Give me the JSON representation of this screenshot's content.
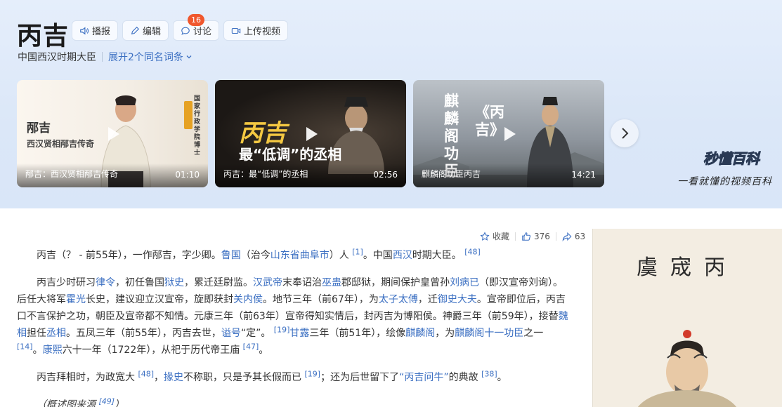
{
  "header": {
    "title": "丙吉",
    "actions": [
      {
        "label": "播报",
        "icon": "speaker-icon"
      },
      {
        "label": "编辑",
        "icon": "pencil-icon"
      },
      {
        "label": "讨论",
        "icon": "chat-icon",
        "badge": "16"
      },
      {
        "label": "上传视频",
        "icon": "video-icon"
      }
    ],
    "subtitle": "中国西汉时期大臣",
    "expand_label": "展开2个同名词条"
  },
  "videos": [
    {
      "art_title": "邴吉",
      "art_sub": "西汉贤相邴吉传奇",
      "art_vertical": "国家行政学院博士",
      "caption": "邴吉：西汉贤相邴吉传奇",
      "duration": "01:10"
    },
    {
      "art_title": "丙吉",
      "art_sub": "最“低调”的丞相",
      "caption": "丙吉：最“低调”的丞相",
      "duration": "02:56"
    },
    {
      "art_title_1": "麒麟阁功臣",
      "art_title_2": "《丙吉》",
      "caption": "麒麟阁功臣丙吉",
      "duration": "14:21"
    }
  ],
  "brand": {
    "name": "秒懂百科",
    "slogan": "一看就懂的视频百科"
  },
  "stats": {
    "collect_label": "收藏",
    "likes": "376",
    "shares": "63"
  },
  "article": {
    "p1": {
      "t1": "丙吉（？ - 前55年），一作邴吉，字少卿。",
      "l1": "鲁国",
      "t2": "（治今",
      "l2": "山东省曲阜市",
      "t3": "）人 ",
      "r1": "[1]",
      "t4": "。中国",
      "l3": "西汉",
      "t5": "时期大臣。 ",
      "r2": "[48]"
    },
    "p2": {
      "t1": "丙吉少时研习",
      "l1": "律令",
      "t2": "，初任鲁国",
      "l2": "狱史",
      "t3": "，累迁廷尉监。",
      "l3": "汉武帝",
      "t4": "末奉诏治",
      "l4": "巫蛊",
      "t5": "郡邸狱，期间保护皇曾孙",
      "l5": "刘病已",
      "t6": "（即汉宣帝刘询）。后任大将军",
      "l6": "霍光",
      "t7": "长史，建议迎立汉宣帝，旋即获封",
      "l7": "关内侯",
      "t8": "。地节三年（前67年），为",
      "l8": "太子太傅",
      "t9": "，迁",
      "l9": "御史大夫",
      "t10": "。宣帝即位后，丙吉口不言保护之功，朝臣及宣帝都不知情。元康三年（前63年）宣帝得知实情后，封丙吉为博阳侯。神爵三年（前59年），接替",
      "l10": "魏相",
      "t11": "担任",
      "l11": "丞相",
      "t12": "。五凤三年（前55年），丙吉去世，",
      "l12": "谥号",
      "t13": "“定”。 ",
      "r1": "[19]",
      "l13": "甘露",
      "t14": "三年（前51年），绘像",
      "l14": "麒麟阁",
      "t15": "，为",
      "l15": "麒麟阁十一功臣",
      "t16": "之一 ",
      "r2": "[14]",
      "t17": "。",
      "l16": "康熙",
      "t18": "六十一年（1722年），从祀于历代帝王庙 ",
      "r3": "[47]",
      "t19": "。"
    },
    "p3": {
      "t1": "丙吉拜相时，为政宽大 ",
      "r1": "[48]",
      "t2": "，",
      "l1": "掾史",
      "t3": "不称职，只是予其长假而已 ",
      "r2": "[19]",
      "t4": "；还为后世留下了",
      "l2": "“丙吉问牛”",
      "t5": "的典故 ",
      "r3": "[38]",
      "t6": "。"
    },
    "p4": {
      "t1": "（概述图来源 ",
      "r1": "[49]",
      "t2": "）"
    }
  },
  "portrait": {
    "seal_text": "虞宬丙"
  }
}
